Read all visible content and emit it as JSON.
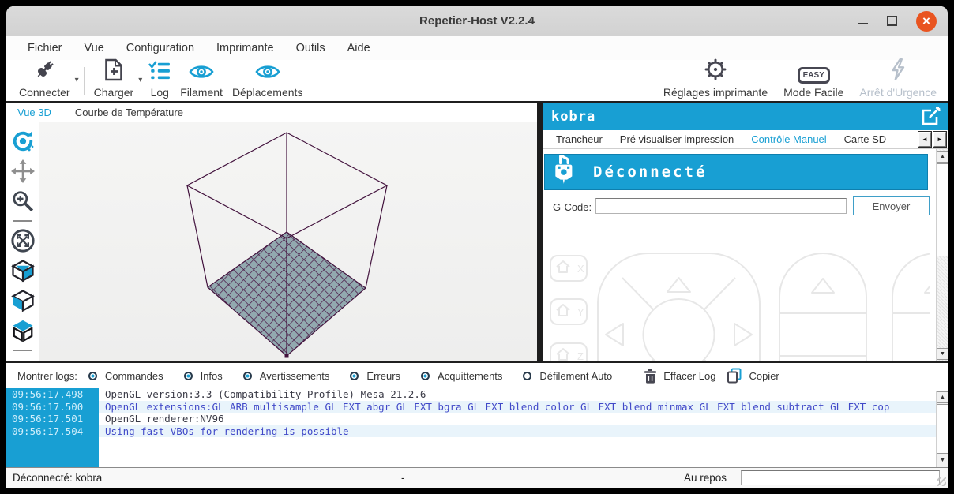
{
  "window": {
    "title": "Repetier-Host V2.2.4"
  },
  "icons": {
    "close": "×",
    "caret_down": "▾",
    "scroll_left": "◄",
    "scroll_right": "►",
    "scroll_up": "▲",
    "scroll_down": "▼"
  },
  "menu": {
    "items": [
      "Fichier",
      "Vue",
      "Configuration",
      "Imprimante",
      "Outils",
      "Aide"
    ]
  },
  "toolbar": {
    "connect": "Connecter",
    "load": "Charger",
    "log": "Log",
    "filament": "Filament",
    "travel": "Déplacements",
    "printer_settings": "Réglages imprimante",
    "easy_mode": "Mode Facile",
    "easy_badge": "EASY",
    "emergency": "Arrêt d'Urgence"
  },
  "left_panel": {
    "tabs": [
      {
        "label": "Vue 3D",
        "active": true
      },
      {
        "label": "Courbe de Température",
        "active": false
      }
    ]
  },
  "right_panel": {
    "printer_name": "kobra",
    "tabs": [
      {
        "label": "Trancheur",
        "active": false
      },
      {
        "label": "Pré visualiser impression",
        "active": false
      },
      {
        "label": "Contrôle Manuel",
        "active": true
      },
      {
        "label": "Carte SD",
        "active": false
      }
    ],
    "status_banner": "Déconnecté",
    "gcode_label": "G-Code:",
    "send_button": "Envoyer",
    "home_axes": [
      "X",
      "Y",
      "Z"
    ]
  },
  "log_panel": {
    "show_logs_label": "Montrer logs:",
    "filters": [
      {
        "label": "Commandes",
        "on": true
      },
      {
        "label": "Infos",
        "on": true
      },
      {
        "label": "Avertissements",
        "on": true
      },
      {
        "label": "Erreurs",
        "on": true
      },
      {
        "label": "Acquittements",
        "on": true
      },
      {
        "label": "Défilement Auto",
        "on": false
      }
    ],
    "clear_label": "Effacer Log",
    "copy_label": "Copier",
    "entries": [
      {
        "time": "09:56:17.498",
        "message": "OpenGL version:3.3 (Compatibility Profile) Mesa 21.2.6",
        "highlight": false
      },
      {
        "time": "09:56:17.500",
        "message": "OpenGL extensions:GL ARB multisample GL EXT abgr GL EXT bgra GL EXT blend color GL EXT blend minmax GL EXT blend subtract GL EXT cop",
        "highlight": true
      },
      {
        "time": "09:56:17.501",
        "message": "OpenGL renderer:NV96",
        "highlight": false
      },
      {
        "time": "09:56:17.504",
        "message": "Using fast VBOs for rendering is possible",
        "highlight": true
      }
    ]
  },
  "status_bar": {
    "left": "Déconnecté: kobra",
    "center": "-",
    "right": "Au repos"
  },
  "colors": {
    "accent": "#189fd3",
    "close_button": "#e95420",
    "wireframe": "#42123d",
    "bed_fill": "#92a9af",
    "log_highlight_bg": "#e9f4fb",
    "log_blue_text": "#4149c8"
  }
}
